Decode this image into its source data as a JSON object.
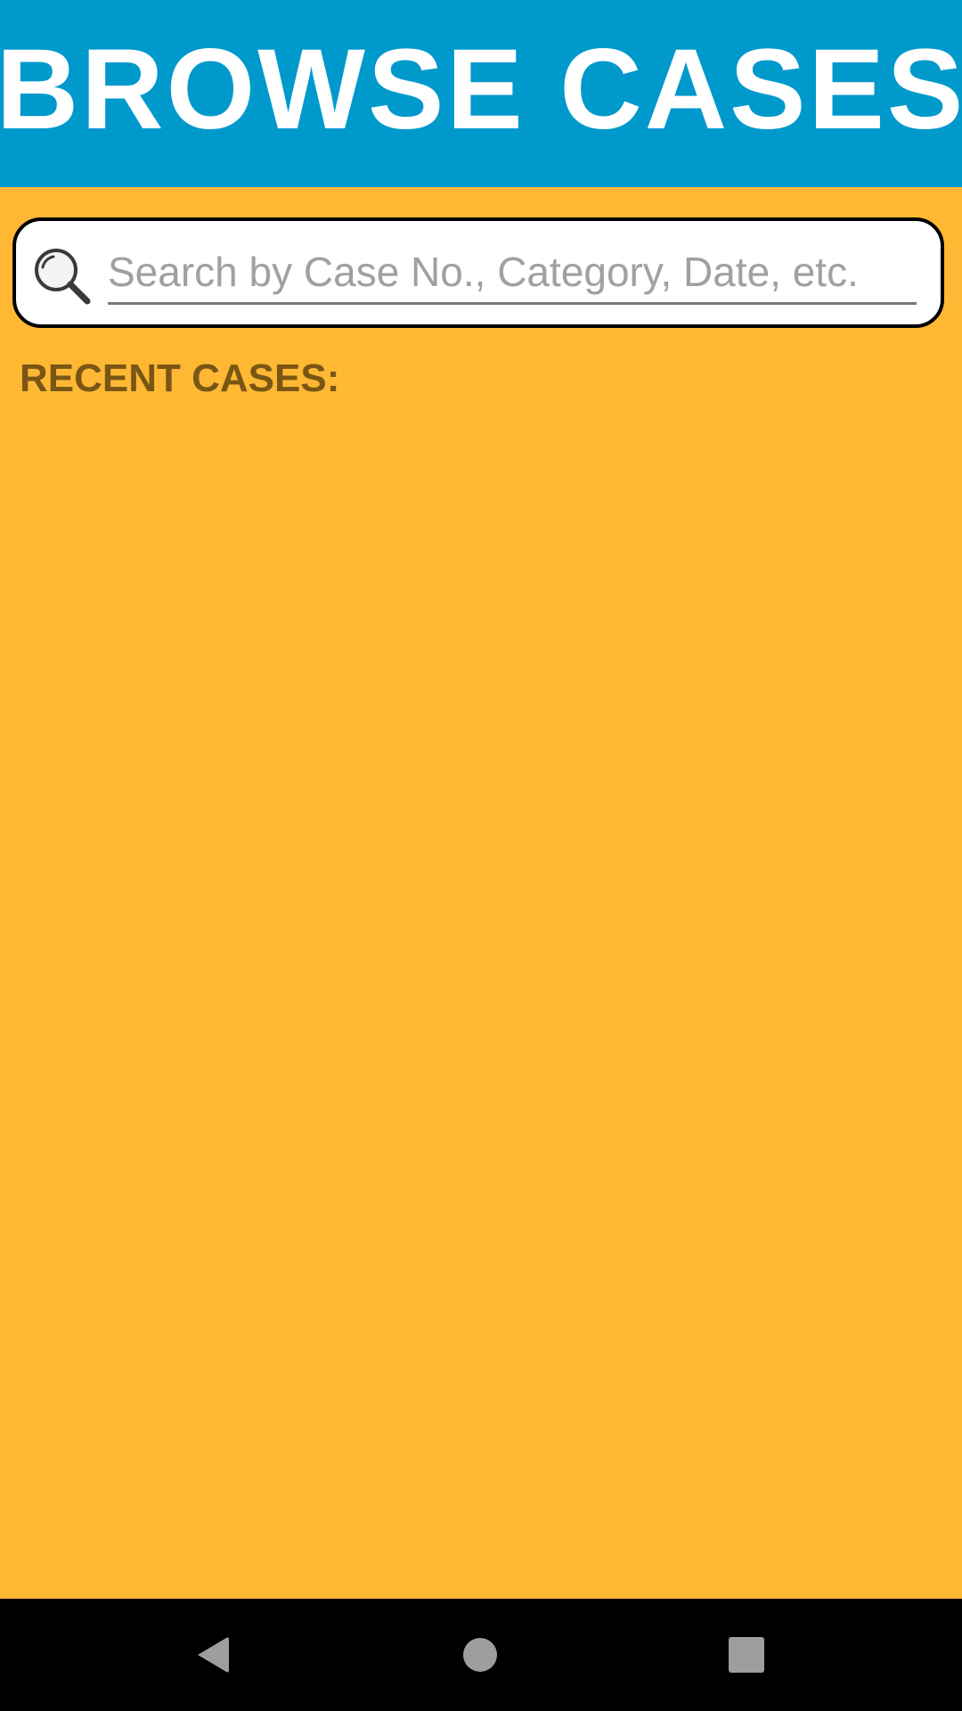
{
  "header": {
    "title": "BROWSE CASES"
  },
  "search": {
    "placeholder": "Search by Case No., Category, Date, etc.",
    "value": "",
    "icon": "search-icon"
  },
  "recent": {
    "label": "RECENT CASES:",
    "items": []
  },
  "nav": {
    "back_icon": "back-icon",
    "home_icon": "home-icon",
    "recents_icon": "recents-icon"
  },
  "colors": {
    "header_bg": "#0099CC",
    "page_bg": "#FFB834",
    "label_text": "#7A5614",
    "nav_bg": "#000000"
  }
}
